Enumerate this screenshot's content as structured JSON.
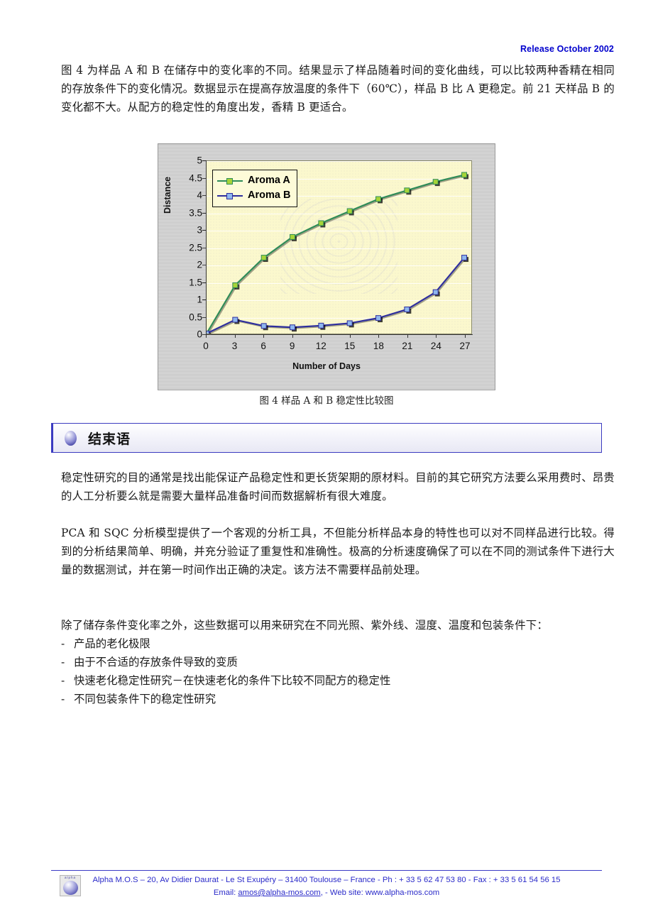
{
  "header": {
    "release": "Release October 2002"
  },
  "intro_paragraph": "图 4 为样品 A 和 B 在储存中的变化率的不同。结果显示了样品随着时间的变化曲线，可以比较两种香精在相同的存放条件下的变化情况。数据显示在提高存放温度的条件下（60℃），样品 B 比 A 更稳定。前 21 天样品 B 的变化都不大。从配方的稳定性的角度出发，香精 B 更适合。",
  "figure": {
    "caption": "图 4 样品 A 和 B  稳定性比较图"
  },
  "chart_data": {
    "type": "line",
    "title": "",
    "xlabel": "Number of Days",
    "ylabel": "Distance",
    "x": [
      0,
      3,
      6,
      9,
      12,
      15,
      18,
      21,
      24,
      27
    ],
    "xtick_labels": [
      "0",
      "3",
      "6",
      "9",
      "12",
      "15",
      "18",
      "21",
      "24",
      "27"
    ],
    "ytick_labels": [
      "0",
      "0.5",
      "1",
      "1.5",
      "2",
      "2.5",
      "3",
      "3.5",
      "4",
      "4.5",
      "5"
    ],
    "ylim": [
      0,
      5
    ],
    "xlim": [
      0,
      27
    ],
    "grid": true,
    "legend_position": "top-left",
    "plot_background": "#fbf8cd",
    "chart_background": "#c3c3c3",
    "series": [
      {
        "name": "Aroma A",
        "color": "#2e8b57",
        "marker_color": "#a6d438",
        "values": [
          0.0,
          1.4,
          2.2,
          2.8,
          3.2,
          3.55,
          3.9,
          4.15,
          4.4,
          4.6
        ]
      },
      {
        "name": "Aroma B",
        "color": "#2e2e9e",
        "marker_color": "#8fb7ee",
        "values": [
          0.0,
          0.4,
          0.22,
          0.18,
          0.23,
          0.3,
          0.45,
          0.7,
          1.2,
          2.2
        ]
      }
    ]
  },
  "section": {
    "title": "结束语",
    "icon": "sphere-bullet-icon"
  },
  "body_paragraphs": [
    "稳定性研究的目的通常是找出能保证产品稳定性和更长货架期的原材料。目前的其它研究方法要么采用费时、昂贵的人工分析要么就是需要大量样品准备时间而数据解析有很大难度。",
    "PCA 和 SQC 分析模型提供了一个客观的分析工具，不但能分析样品本身的特性也可以对不同样品进行比较。得到的分析结果简单、明确，并充分验证了重复性和准确性。极高的分析速度确保了可以在不同的测试条件下进行大量的数据测试，并在第一时间作出正确的决定。该方法不需要样品前处理。",
    "除了储存条件变化率之外，这些数据可以用来研究在不同光照、紫外线、湿度、温度和包装条件下："
  ],
  "bullets": [
    "产品的老化极限",
    "由于不合适的存放条件导致的变质",
    "快速老化稳定性研究－在快速老化的条件下比较不同配方的稳定性",
    "不同包装条件下的稳定性研究"
  ],
  "bullet_dash": "-",
  "footer": {
    "logo_word": "alpha",
    "line1": "Alpha M.O.S – 20, Av Didier Daurat - Le St Exupéry – 31400 Toulouse – France - Ph : + 33 5 62 47 53 80 - Fax : + 33 5 61 54 56 15",
    "email_prefix": "Email: ",
    "email": "amos@alpha-mos.com",
    "email_suffix": ", - Web site: ",
    "website": "www.alpha-mos.com",
    "accent_color": "#2b2bc9"
  }
}
